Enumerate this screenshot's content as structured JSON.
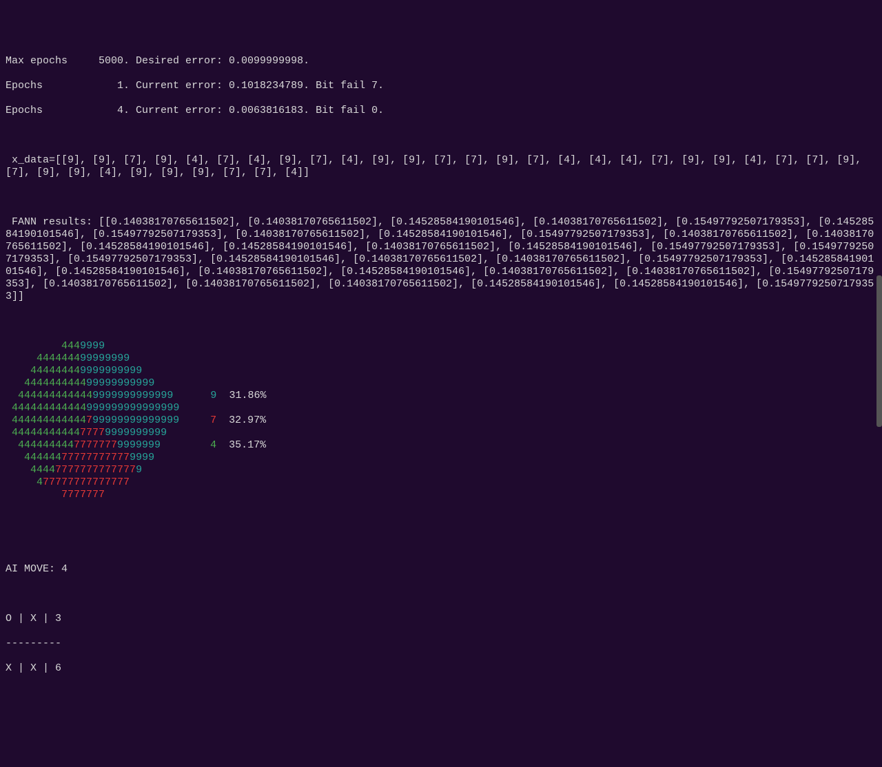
{
  "training": {
    "line1": "Max epochs     5000. Desired error: 0.0099999998.",
    "line2": "Epochs            1. Current error: 0.1018234789. Bit fail 7.",
    "line3": "Epochs            4. Current error: 0.0063816183. Bit fail 0."
  },
  "xdata": " x_data=[[9], [9], [7], [9], [4], [7], [4], [9], [7], [4], [9], [9], [7], [7], [9], [7], [4], [4], [4], [7], [9], [9], [4], [7], [7], [9], [7], [9], [9], [4], [9], [9], [9], [7], [7], [4]]",
  "fann_results": " FANN results: [[0.14038170765611502], [0.14038170765611502], [0.14528584190101546], [0.14038170765611502], [0.15497792507179353], [0.14528584190101546], [0.15497792507179353], [0.14038170765611502], [0.14528584190101546], [0.15497792507179353], [0.14038170765611502], [0.14038170765611502], [0.14528584190101546], [0.14528584190101546], [0.14038170765611502], [0.14528584190101546], [0.15497792507179353], [0.15497792507179353], [0.15497792507179353], [0.14528584190101546], [0.14038170765611502], [0.14038170765611502], [0.15497792507179353], [0.14528584190101546], [0.14528584190101546], [0.14038170765611502], [0.14528584190101546], [0.14038170765611502], [0.14038170765611502], [0.15497792507179353], [0.14038170765611502], [0.14038170765611502], [0.14038170765611502], [0.14528584190101546], [0.14528584190101546], [0.15497792507179353]]",
  "pie": {
    "rows": [
      {
        "pre": "         ",
        "segs": [
          [
            "4449999",
            "mix"
          ]
        ],
        "legend": null
      },
      {
        "pre": "     ",
        "segs": [
          [
            "444444499999999",
            "mix"
          ]
        ],
        "legend": null
      },
      {
        "pre": "    ",
        "segs": [
          [
            "444444449999999999",
            "mix"
          ]
        ],
        "legend": null
      },
      {
        "pre": "   ",
        "segs": [
          [
            "444444444499999999999",
            "mix"
          ]
        ],
        "legend": null
      },
      {
        "pre": "  ",
        "segs": [
          [
            "4444444444449999999999999",
            "mix"
          ]
        ],
        "legend": {
          "sym": "9",
          "pct": "31.86%"
        }
      },
      {
        "pre": " ",
        "segs": [
          [
            "444444444444999999999999999",
            "mix"
          ]
        ],
        "legend": null
      },
      {
        "pre": " ",
        "segs": [
          [
            "444444444444",
            "4"
          ],
          [
            "7",
            "7"
          ],
          [
            "99999999999999",
            "9"
          ]
        ],
        "legend": {
          "sym": "7",
          "pct": "32.97%"
        }
      },
      {
        "pre": " ",
        "segs": [
          [
            "44444444444",
            "4"
          ],
          [
            "7777",
            "7"
          ],
          [
            "9999999999",
            "9"
          ]
        ],
        "legend": null
      },
      {
        "pre": "  ",
        "segs": [
          [
            "444444444",
            "4"
          ],
          [
            "7777777",
            "7"
          ],
          [
            "9999999",
            "9"
          ]
        ],
        "legend": {
          "sym": "4",
          "pct": "35.17%"
        }
      },
      {
        "pre": "   ",
        "segs": [
          [
            "444444",
            "4"
          ],
          [
            "77777777777",
            "7"
          ],
          [
            "9999",
            "9"
          ]
        ],
        "legend": null
      },
      {
        "pre": "    ",
        "segs": [
          [
            "4444",
            "4"
          ],
          [
            "7777777777777",
            "7"
          ],
          [
            "9",
            "9"
          ]
        ],
        "legend": null
      },
      {
        "pre": "     ",
        "segs": [
          [
            "4",
            "4"
          ],
          [
            "77777777777777",
            "7"
          ]
        ],
        "legend": null
      },
      {
        "pre": "         ",
        "segs": [
          [
            "7777777",
            "7"
          ]
        ],
        "legend": null
      }
    ]
  },
  "ai_move": "AI MOVE: 4",
  "board": {
    "row1": "O | X | 3",
    "sep": "---------",
    "row2": "X | X | 6"
  }
}
